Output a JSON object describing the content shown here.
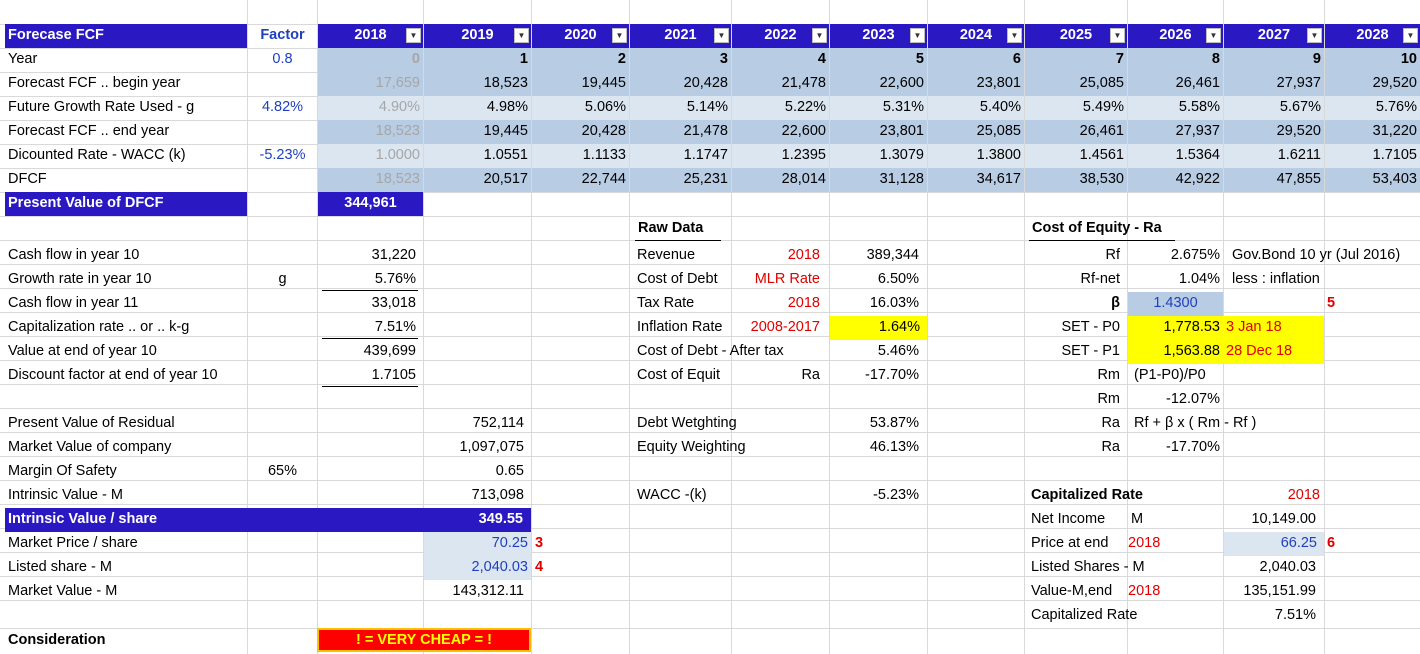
{
  "header": {
    "title": "Forecase FCF",
    "factor_label": "Factor",
    "years": [
      "2018",
      "2019",
      "2020",
      "2021",
      "2022",
      "2023",
      "2024",
      "2025",
      "2026",
      "2027",
      "2028"
    ],
    "dropdown_glyph": "▼"
  },
  "forecast": {
    "rows": [
      {
        "label": "Year",
        "factor": "0.8",
        "values": [
          "0",
          "1",
          "2",
          "3",
          "4",
          "5",
          "6",
          "7",
          "8",
          "9",
          "10"
        ]
      },
      {
        "label": "Forecast FCF .. begin year",
        "factor": "",
        "values": [
          "17,659",
          "18,523",
          "19,445",
          "20,428",
          "21,478",
          "22,600",
          "23,801",
          "25,085",
          "26,461",
          "27,937",
          "29,520"
        ]
      },
      {
        "label": "Future Growth Rate Used - g",
        "factor": "4.82%",
        "values": [
          "4.90%",
          "4.98%",
          "5.06%",
          "5.14%",
          "5.22%",
          "5.31%",
          "5.40%",
          "5.49%",
          "5.58%",
          "5.67%",
          "5.76%"
        ]
      },
      {
        "label": "Forecast FCF .. end year",
        "factor": "",
        "values": [
          "18,523",
          "19,445",
          "20,428",
          "21,478",
          "22,600",
          "23,801",
          "25,085",
          "26,461",
          "27,937",
          "29,520",
          "31,220"
        ]
      },
      {
        "label": "Dicounted Rate - WACC (k)",
        "factor": "-5.23%",
        "values": [
          "1.0000",
          "1.0551",
          "1.1133",
          "1.1747",
          "1.2395",
          "1.3079",
          "1.3800",
          "1.4561",
          "1.5364",
          "1.6211",
          "1.7105"
        ]
      },
      {
        "label": "DFCF",
        "factor": "",
        "values": [
          "18,523",
          "20,517",
          "22,744",
          "25,231",
          "28,014",
          "31,128",
          "34,617",
          "38,530",
          "42,922",
          "47,855",
          "53,403"
        ]
      }
    ],
    "pv_label": "Present Value of DFCF",
    "pv_value": "344,961"
  },
  "terminal": {
    "rows": [
      {
        "label": "Cash flow in year 10",
        "mid": "",
        "value": "31,220"
      },
      {
        "label": "Growth rate in year 10",
        "mid": "g",
        "value": "5.76%"
      },
      {
        "label": "Cash flow in year 11",
        "mid": "",
        "value": "33,018"
      },
      {
        "label": "Capitalization rate .. or .. k-g",
        "mid": "",
        "value": "7.51%"
      },
      {
        "label": "Value at end of year 10",
        "mid": "",
        "value": "439,699"
      },
      {
        "label": "Discount factor at end of year 10",
        "mid": "",
        "value": "1.7105"
      }
    ]
  },
  "valuation": {
    "pv_residual_label": "Present Value of Residual",
    "pv_residual": "752,114",
    "market_value_label": "Market Value of company",
    "market_value": "1,097,075",
    "mos_label": "Margin Of Safety",
    "mos_pct": "65%",
    "mos_value": "0.65",
    "intrinsic_label": "Intrinsic Value - M",
    "intrinsic": "713,098",
    "ivs_label": "Intrinsic Value / share",
    "ivs": "349.55",
    "price_label": "Market Price / share",
    "price": "70.25",
    "price_note": "3",
    "shares_label": "Listed share - M",
    "shares": "2,040.03",
    "shares_note": "4",
    "mv_label": "Market Value - M",
    "mv": "143,312.11",
    "consideration_label": "Consideration",
    "consideration_value": "! = VERY CHEAP = !"
  },
  "raw_data": {
    "title": "Raw Data",
    "rows": [
      {
        "label": "Revenue",
        "note": "2018",
        "value": "389,344"
      },
      {
        "label": "Cost of Debt",
        "note": "MLR Rate",
        "value": "6.50%"
      },
      {
        "label": "Tax Rate",
        "note": "2018",
        "value": "16.03%"
      },
      {
        "label": "Inflation Rate",
        "note": "2008-2017",
        "value": "1.64%"
      },
      {
        "label": "Cost of Debt - After tax",
        "note": "",
        "value": "5.46%"
      },
      {
        "label": "Cost of Equit",
        "note": "Ra",
        "value": "-17.70%"
      }
    ],
    "debt_w_label": "Debt Wetghting",
    "debt_w": "53.87%",
    "eq_w_label": "Equity Weighting",
    "eq_w": "46.13%",
    "wacc_label": "WACC -(k)",
    "wacc": "-5.23%"
  },
  "cost_of_equity": {
    "title": "Cost of Equity - Ra",
    "rf_label": "Rf",
    "rf": "2.675%",
    "rf_note": "Gov.Bond 10 yr (Jul 2016)",
    "rfnet_label": "Rf-net",
    "rfnet": "1.04%",
    "rfnet_note": "less : inflation",
    "beta_label": "β",
    "beta": "1.4300",
    "beta_note": "5",
    "p0_label": "SET - P0",
    "p0": "1,778.53",
    "p0_date": "3 Jan 18",
    "p1_label": "SET - P1",
    "p1": "1,563.88",
    "p1_date": "28 Dec 18",
    "rm_label": "Rm",
    "rm_formula": "(P1-P0)/P0",
    "rm2_label": "Rm",
    "rm": "-12.07%",
    "ra_label": "Ra",
    "ra_formula": "Rf + β x ( Rm - Rf )",
    "ra2_label": "Ra",
    "ra": "-17.70%"
  },
  "capitalized": {
    "title": "Capitalized Rate",
    "year": "2018",
    "ni_label": "Net Income",
    "ni_unit": "M",
    "ni": "10,149.00",
    "pe_label": "Price at end",
    "pe_year": "2018",
    "pe": "66.25",
    "pe_note": "6",
    "ls_label": "Listed Shares - M",
    "ls": "2,040.03",
    "ve_label": "Value-M,end",
    "ve_year": "2018",
    "ve": "135,151.99",
    "cr_label": "Capitalized Rate",
    "cr": "7.51%"
  }
}
